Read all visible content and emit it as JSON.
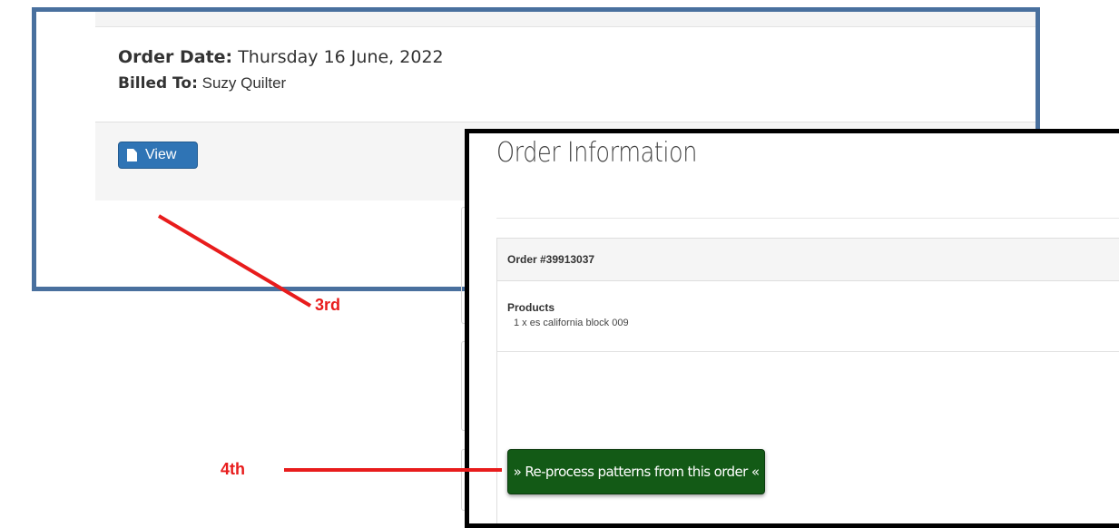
{
  "order_card": {
    "date_label": "Order Date:",
    "date_value": "Thursday 16 June, 2022",
    "billed_label": "Billed To:",
    "billed_value": "Suzy Quilter",
    "view_button": "View",
    "view_icon": "document-icon"
  },
  "order_info": {
    "title": "Order Information",
    "order_number": "Order #39913037",
    "products_label": "Products",
    "products": [
      "1 x es california block 009"
    ],
    "reprocess_button": "» Re-process patterns from this order «"
  },
  "annotations": {
    "third": "3rd",
    "fourth": "4th",
    "color": "#e81c1c"
  },
  "colors": {
    "frame_blue": "#49709e",
    "view_button": "#2f74b5",
    "reprocess_button": "#135a16"
  }
}
